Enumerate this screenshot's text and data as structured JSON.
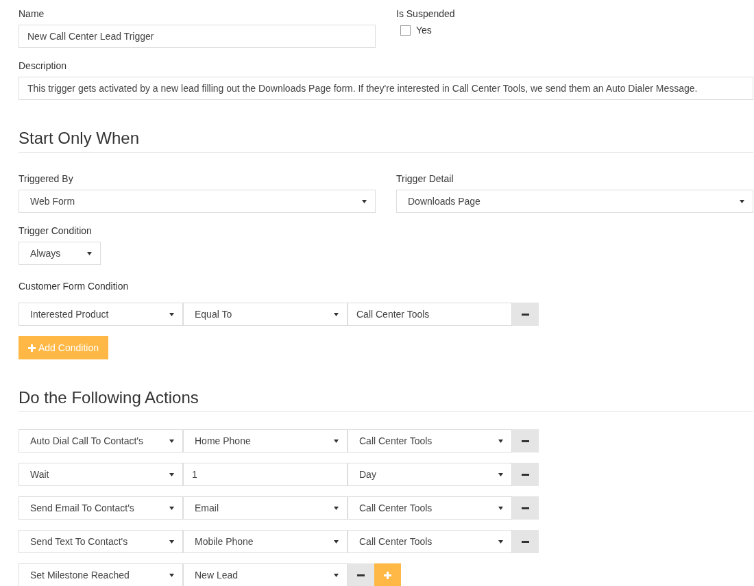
{
  "name": {
    "label": "Name",
    "value": "New Call Center Lead Trigger"
  },
  "suspended": {
    "label": "Is Suspended",
    "option": "Yes",
    "checked": false
  },
  "description": {
    "label": "Description",
    "value": "This trigger gets activated by a new lead filling out the Downloads Page form. If they're interested in Call Center Tools, we send them an Auto Dialer Message."
  },
  "start_section": {
    "title": "Start Only When",
    "triggered_by": {
      "label": "Triggered By",
      "value": "Web Form"
    },
    "trigger_detail": {
      "label": "Trigger Detail",
      "value": "Downloads Page"
    },
    "trigger_condition": {
      "label": "Trigger Condition",
      "value": "Always"
    },
    "customer_form_condition": {
      "label": "Customer Form Condition",
      "rows": [
        {
          "fields": [
            {
              "kind": "select",
              "value": "Interested Product"
            },
            {
              "kind": "select",
              "value": "Equal To"
            },
            {
              "kind": "input",
              "value": "Call Center Tools"
            }
          ],
          "buttons": [
            {
              "kind": "remove"
            }
          ]
        }
      ]
    },
    "add_button": {
      "label": "Add Condition"
    }
  },
  "actions_section": {
    "title": "Do the Following Actions",
    "rows": [
      {
        "fields": [
          {
            "kind": "select",
            "value": "Auto Dial Call To Contact's"
          },
          {
            "kind": "select",
            "value": "Home Phone"
          },
          {
            "kind": "select",
            "value": "Call Center Tools"
          }
        ],
        "buttons": [
          {
            "kind": "remove"
          }
        ]
      },
      {
        "fields": [
          {
            "kind": "select",
            "value": "Wait"
          },
          {
            "kind": "input",
            "value": "1"
          },
          {
            "kind": "select",
            "value": "Day"
          }
        ],
        "buttons": [
          {
            "kind": "remove"
          }
        ]
      },
      {
        "fields": [
          {
            "kind": "select",
            "value": "Send Email To Contact's"
          },
          {
            "kind": "select",
            "value": "Email"
          },
          {
            "kind": "select",
            "value": "Call Center Tools"
          }
        ],
        "buttons": [
          {
            "kind": "remove"
          }
        ]
      },
      {
        "fields": [
          {
            "kind": "select",
            "value": "Send Text To Contact's"
          },
          {
            "kind": "select",
            "value": "Mobile Phone"
          },
          {
            "kind": "select",
            "value": "Call Center Tools"
          }
        ],
        "buttons": [
          {
            "kind": "remove"
          }
        ]
      },
      {
        "fields": [
          {
            "kind": "select",
            "value": "Set Milestone Reached"
          },
          {
            "kind": "select",
            "value": "New Lead"
          }
        ],
        "buttons": [
          {
            "kind": "remove"
          },
          {
            "kind": "add"
          }
        ]
      }
    ]
  }
}
